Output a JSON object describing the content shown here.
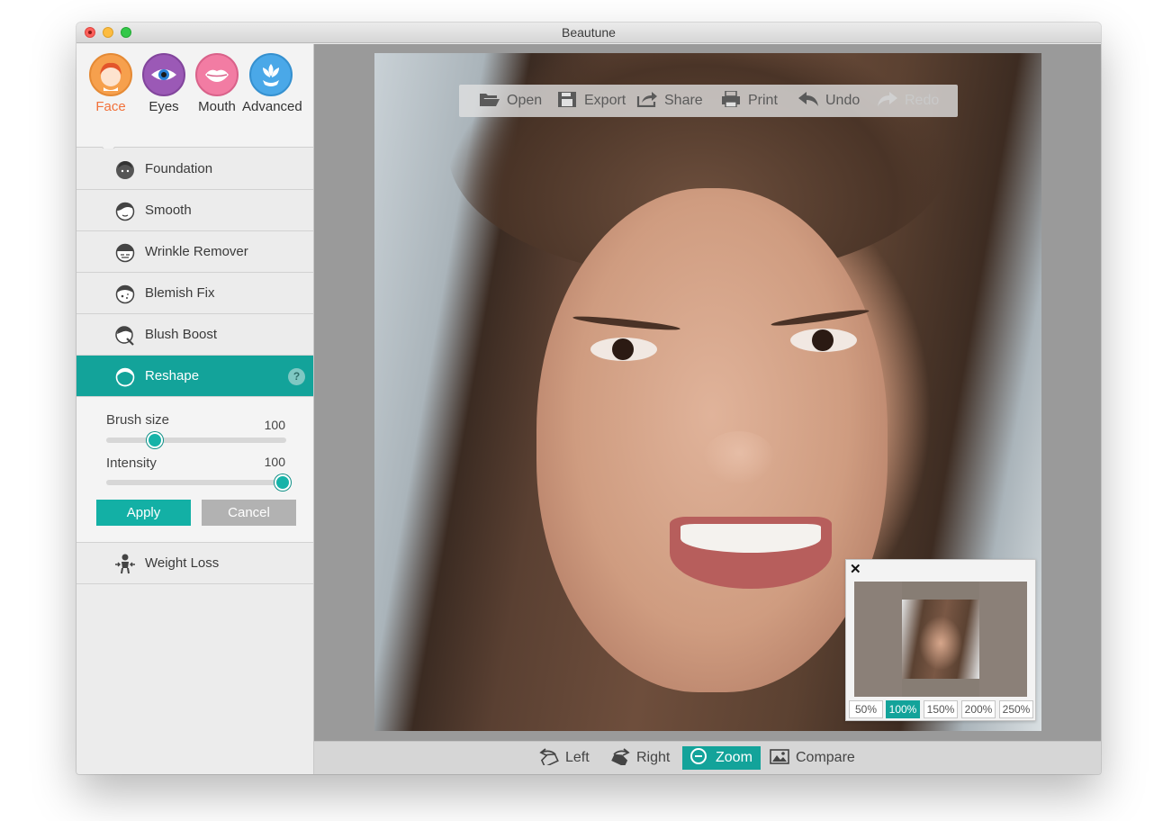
{
  "window": {
    "title": "Beautune"
  },
  "categories": [
    {
      "label": "Face",
      "color": "#f6a04d",
      "icon": "face-icon",
      "active": true
    },
    {
      "label": "Eyes",
      "color": "#9b59b6",
      "icon": "eye-icon",
      "active": false
    },
    {
      "label": "Mouth",
      "color": "#f27ca3",
      "icon": "lips-icon",
      "active": false
    },
    {
      "label": "Advanced",
      "color": "#4aa8e8",
      "icon": "flower-icon",
      "active": false
    }
  ],
  "tools": {
    "foundation": "Foundation",
    "smooth": "Smooth",
    "wrinkle": "Wrinkle Remover",
    "blemish": "Blemish Fix",
    "blush": "Blush Boost",
    "reshape": "Reshape",
    "weightloss": "Weight Loss",
    "help": "?"
  },
  "reshape_panel": {
    "brush_label": "Brush size",
    "brush_value": "100",
    "brush_level": 0.27,
    "intensity_label": "Intensity",
    "intensity_value": "100",
    "intensity_level": 1.0,
    "apply": "Apply",
    "cancel": "Cancel"
  },
  "float_toolbar": {
    "open": "Open",
    "export": "Export",
    "share": "Share",
    "print": "Print",
    "undo": "Undo",
    "redo": "Redo"
  },
  "navigator": {
    "close": "✕",
    "zoom_levels": [
      "50%",
      "100%",
      "150%",
      "200%",
      "250%"
    ],
    "active_zoom": "100%"
  },
  "bottom_bar": {
    "left": "Left",
    "right": "Right",
    "zoom": "Zoom",
    "compare": "Compare"
  },
  "colors": {
    "accent": "#13a39a",
    "face_active_label": "#f2713a"
  }
}
